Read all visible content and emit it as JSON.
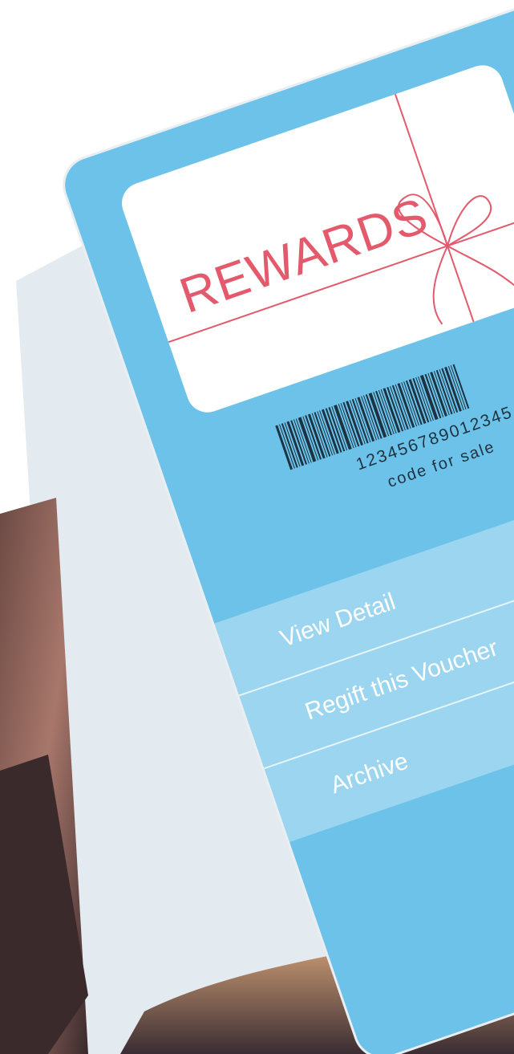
{
  "card": {
    "title": "REWARDS",
    "barcode_number": "123456789012345",
    "barcode_caption": "code for sale"
  },
  "menu": {
    "items": [
      {
        "label": "View Detail"
      },
      {
        "label": "Regift this Voucher"
      },
      {
        "label": "Archive"
      }
    ]
  },
  "colors": {
    "screen": "#6cc2e8",
    "accent": "#e25a6c",
    "barcode": "#1e3342"
  }
}
